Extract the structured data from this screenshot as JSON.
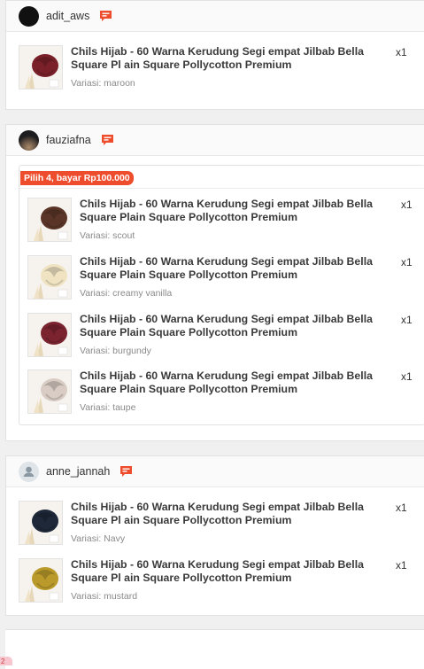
{
  "orders": [
    {
      "username": "adit_aws",
      "items": [
        {
          "title": "Chils Hijab - 60 Warna Kerudung Segi empat Jilbab Bella Square Pl ain Square Pollycotton Premium",
          "variant": "Variasi: maroon",
          "qty": "x1",
          "color": "#7a2029"
        }
      ]
    },
    {
      "username": "fauziafna",
      "bundle_badge": "Pilih 4, bayar Rp100.000",
      "items": [
        {
          "title": "Chils Hijab - 60 Warna Kerudung Segi empat Jilbab Bella Square Plain Square Pollycotton Premium",
          "variant": "Variasi: scout",
          "qty": "x1",
          "color": "#5a3527"
        },
        {
          "title": "Chils Hijab - 60 Warna Kerudung Segi empat Jilbab Bella Square Plain Square Pollycotton Premium",
          "variant": "Variasi: creamy vanilla",
          "qty": "x1",
          "color": "#efe3c2"
        },
        {
          "title": "Chils Hijab - 60 Warna Kerudung Segi empat Jilbab Bella Square Plain Square Pollycotton Premium",
          "variant": "Variasi: burgundy",
          "qty": "x1",
          "color": "#7b2430"
        },
        {
          "title": "Chils Hijab - 60 Warna Kerudung Segi empat Jilbab Bella Square Plain Square Pollycotton Premium",
          "variant": "Variasi: taupe",
          "qty": "x1",
          "color": "#d8ccc4"
        }
      ]
    },
    {
      "username": "anne_jannah",
      "items": [
        {
          "title": "Chils Hijab - 60 Warna Kerudung Segi empat Jilbab Bella Square Pl ain Square Pollycotton Premium",
          "variant": "Variasi: Navy",
          "qty": "x1",
          "color": "#1e2838"
        },
        {
          "title": "Chils Hijab - 60 Warna Kerudung Segi empat Jilbab Bella Square Pl ain Square Pollycotton Premium",
          "variant": "Variasi: mustard",
          "qty": "x1",
          "color": "#b99a2a"
        }
      ]
    }
  ],
  "corner_tag": "2",
  "colors": {
    "accent": "#ee4d2d",
    "chat_icon": "#ee4d2d"
  },
  "icons": {
    "chat": "chat-bubble-icon",
    "default_avatar": "user-silhouette-icon"
  }
}
